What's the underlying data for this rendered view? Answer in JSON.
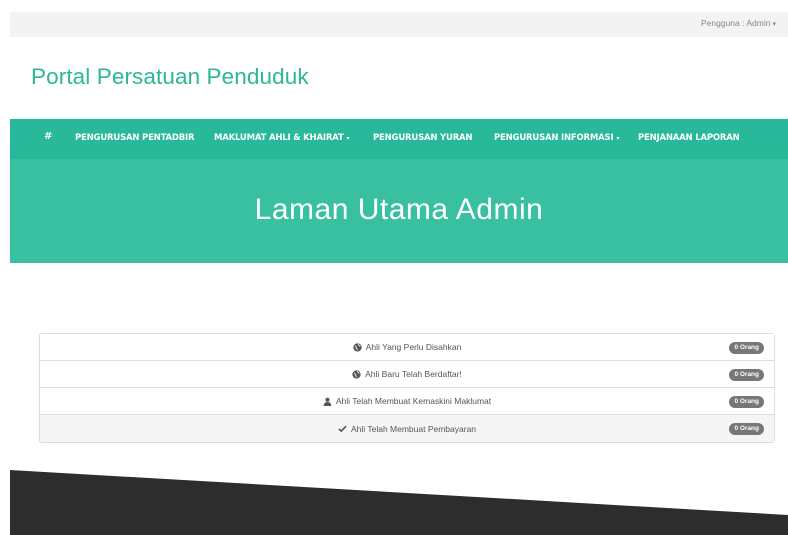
{
  "topbar": {
    "user_label": "Pengguna : Admin"
  },
  "brand": {
    "title": "Portal Persatuan Penduduk"
  },
  "nav": {
    "home_icon": "home-icon",
    "items": [
      {
        "label": "PENGURUSAN PENTADBIR",
        "dropdown": false
      },
      {
        "label": "MAKLUMAT AHLI & KHAIRAT",
        "dropdown": true
      },
      {
        "label": "PENGURUSAN YURAN",
        "dropdown": false
      },
      {
        "label": "PENGURUSAN INFORMASI",
        "dropdown": true
      },
      {
        "label": "PENJANAAN LAPORAN",
        "dropdown": false
      }
    ]
  },
  "hero": {
    "title": "Laman Utama Admin"
  },
  "list": {
    "rows": [
      {
        "icon": "globe-icon",
        "label": "Ahli Yang Perlu Disahkan",
        "badge": "0 Orang"
      },
      {
        "icon": "globe-icon",
        "label": "Ahli Baru Telah Berdaftar!",
        "badge": "0 Orang"
      },
      {
        "icon": "user-icon",
        "label": "Ahli Telah Membuat Kemaskini Maklumat",
        "badge": "0 Orang"
      },
      {
        "icon": "check-icon",
        "label": "Ahli Telah Membuat Pembayaran",
        "badge": "0 Orang"
      }
    ]
  },
  "colors": {
    "accent": "#27b99a",
    "hero": "#38c0a0",
    "brand_text": "#2cb895",
    "footer": "#2d2d2d"
  }
}
